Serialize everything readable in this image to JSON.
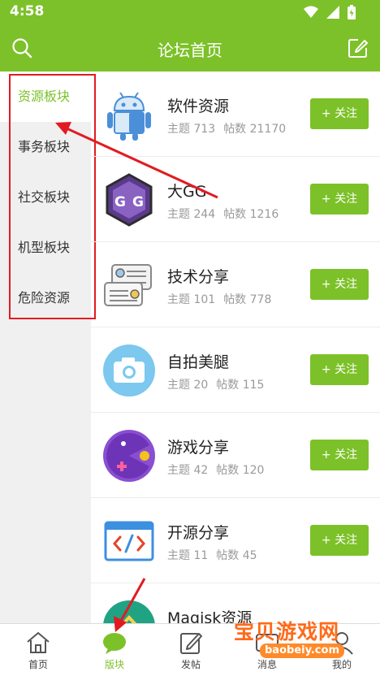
{
  "status_bar": {
    "time": "4:58"
  },
  "header": {
    "title": "论坛首页"
  },
  "sidebar": {
    "items": [
      {
        "label": "资源板块",
        "active": true
      },
      {
        "label": "事务板块"
      },
      {
        "label": "社交板块"
      },
      {
        "label": "机型板块"
      },
      {
        "label": "危险资源"
      }
    ]
  },
  "forums": [
    {
      "name": "软件资源",
      "topics_label": "主题",
      "topics": "713",
      "posts_label": "帖数",
      "posts": "21170",
      "follow_label": "+ 关注",
      "icon": "android-robot-icon"
    },
    {
      "name": "大GG",
      "topics_label": "主题",
      "topics": "244",
      "posts_label": "帖数",
      "posts": "1216",
      "follow_label": "+ 关注",
      "icon": "game-guardian-icon"
    },
    {
      "name": "技术分享",
      "topics_label": "主题",
      "topics": "101",
      "posts_label": "帖数",
      "posts": "778",
      "follow_label": "+ 关注",
      "icon": "chat-bubbles-icon"
    },
    {
      "name": "自拍美腿",
      "topics_label": "主题",
      "topics": "20",
      "posts_label": "帖数",
      "posts": "115",
      "follow_label": "+ 关注",
      "icon": "camera-icon"
    },
    {
      "name": "游戏分享",
      "topics_label": "主题",
      "topics": "42",
      "posts_label": "帖数",
      "posts": "120",
      "follow_label": "+ 关注",
      "icon": "pacman-game-icon"
    },
    {
      "name": "开源分享",
      "topics_label": "主题",
      "topics": "11",
      "posts_label": "帖数",
      "posts": "45",
      "follow_label": "+ 关注",
      "icon": "code-window-icon"
    },
    {
      "name": "Magisk资源",
      "icon": "magisk-icon"
    }
  ],
  "bottom_nav": {
    "items": [
      {
        "label": "首页",
        "icon": "home-icon"
      },
      {
        "label": "版块",
        "icon": "chat-bubble-icon",
        "active": true
      },
      {
        "label": "发帖",
        "icon": "edit-icon"
      },
      {
        "label": "消息",
        "icon": "message-icon"
      },
      {
        "label": "我的",
        "icon": "user-icon"
      }
    ]
  },
  "watermark": {
    "text": "宝贝游戏网",
    "url": "baobeiy.com"
  },
  "colors": {
    "accent": "#7cc129",
    "annotation": "#e21b22"
  }
}
